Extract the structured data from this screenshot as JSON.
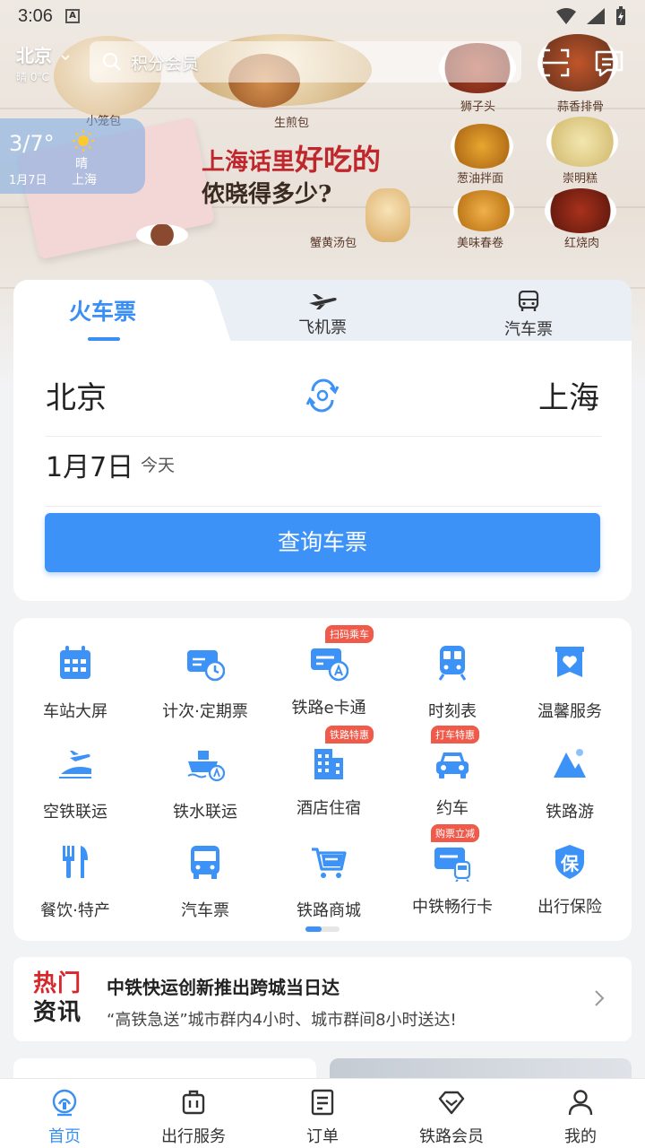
{
  "status_bar": {
    "time": "3:06"
  },
  "header": {
    "city": "北京",
    "weather_brief": "晴 0℃",
    "search_placeholder": "积分会员"
  },
  "weather_card": {
    "temp": "3/7°",
    "date": "1月7日",
    "condition": "晴",
    "place": "上海"
  },
  "banner": {
    "headline_1a": "上海话里",
    "headline_1b": "好吃的",
    "headline_2": "侬晓得多少?",
    "dishes": [
      "小笼包",
      "生煎包",
      "蟹黄汤包",
      "狮子头",
      "蒜香排骨",
      "葱油拌面",
      "崇明糕",
      "美味春卷",
      "红烧肉"
    ]
  },
  "ticket_tabs": [
    "火车票",
    "飞机票",
    "汽车票"
  ],
  "ticket_form": {
    "from_city": "北京",
    "to_city": "上海",
    "date": "1月7日",
    "date_note": "今天",
    "query_button": "查询车票"
  },
  "services": [
    {
      "label": "车站大屏",
      "icon": "calendar-icon",
      "tag": ""
    },
    {
      "label": "计次·定期票",
      "icon": "ticket-clock-icon",
      "tag": ""
    },
    {
      "label": "铁路e卡通",
      "icon": "card-rail-icon",
      "tag": "扫码乘车"
    },
    {
      "label": "时刻表",
      "icon": "train-front-icon",
      "tag": ""
    },
    {
      "label": "温馨服务",
      "icon": "heart-box-icon",
      "tag": ""
    },
    {
      "label": "空铁联运",
      "icon": "plane-train-icon",
      "tag": ""
    },
    {
      "label": "铁水联运",
      "icon": "ship-rail-icon",
      "tag": ""
    },
    {
      "label": "酒店住宿",
      "icon": "hotel-icon",
      "tag": "铁路特惠"
    },
    {
      "label": "约车",
      "icon": "car-icon",
      "tag": "打车特惠"
    },
    {
      "label": "铁路游",
      "icon": "mountain-icon",
      "tag": ""
    },
    {
      "label": "餐饮·特产",
      "icon": "fork-knife-icon",
      "tag": ""
    },
    {
      "label": "汽车票",
      "icon": "bus-icon",
      "tag": ""
    },
    {
      "label": "铁路商城",
      "icon": "cart-icon",
      "tag": ""
    },
    {
      "label": "中铁畅行卡",
      "icon": "card-train-icon",
      "tag": "购票立减"
    },
    {
      "label": "出行保险",
      "icon": "shield-icon",
      "tag": ""
    }
  ],
  "news": {
    "logo_line1": "热门",
    "logo_line2": "资讯",
    "title": "中铁快运创新推出跨城当日达",
    "desc": "“高铁急送”城市群内4小时、城市群间8小时送达!"
  },
  "bottom_nav": [
    {
      "label": "首页",
      "icon": "home-rail-icon",
      "active": true
    },
    {
      "label": "出行服务",
      "icon": "luggage-icon",
      "active": false
    },
    {
      "label": "订单",
      "icon": "order-icon",
      "active": false
    },
    {
      "label": "铁路会员",
      "icon": "diamond-icon",
      "active": false
    },
    {
      "label": "我的",
      "icon": "user-icon",
      "active": false
    }
  ],
  "colors": {
    "accent": "#3c92f6",
    "tag_red": "#f05a4a",
    "headline_red": "#c0272d"
  }
}
